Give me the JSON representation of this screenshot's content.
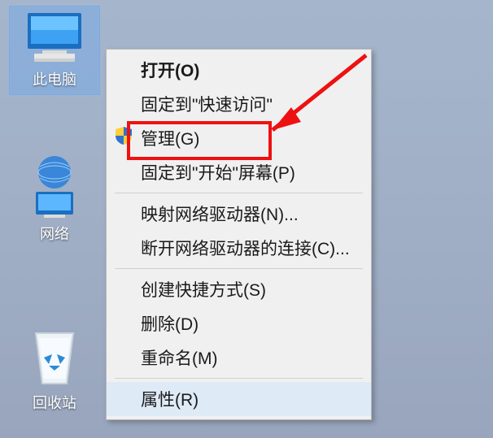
{
  "desktop": {
    "this_pc": "此电脑",
    "network": "网络",
    "recycle": "回收站"
  },
  "menu": {
    "open": "打开(O)",
    "pin_quick": "固定到\"快速访问\"",
    "manage": "管理(G)",
    "pin_start": "固定到\"开始\"屏幕(P)",
    "map_drive": "映射网络驱动器(N)...",
    "disconnect_drive": "断开网络驱动器的连接(C)...",
    "shortcut": "创建快捷方式(S)",
    "delete": "删除(D)",
    "rename": "重命名(M)",
    "properties": "属性(R)"
  }
}
